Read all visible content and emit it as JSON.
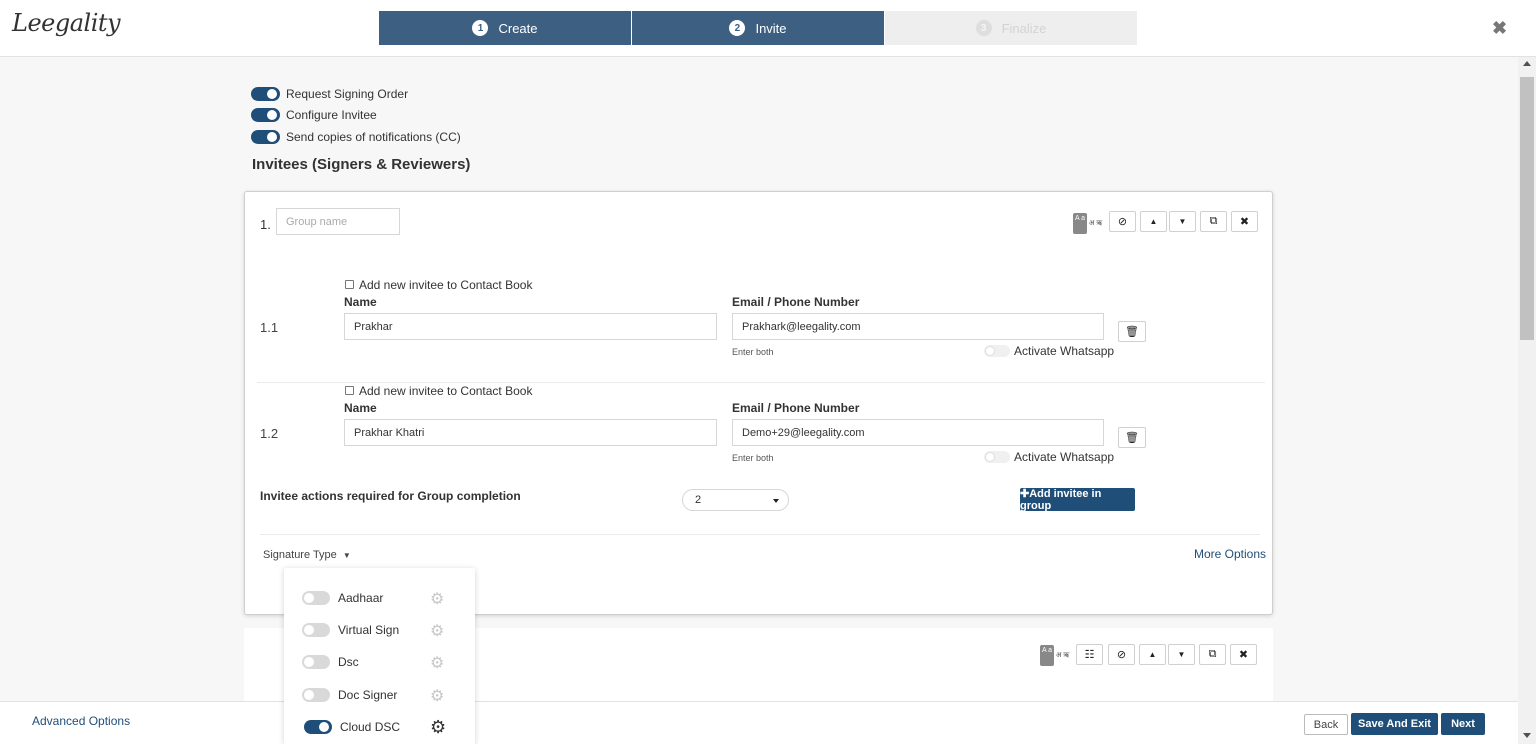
{
  "header": {
    "logo": "Leegality",
    "steps": [
      {
        "num": "1",
        "label": "Create"
      },
      {
        "num": "2",
        "label": "Invite"
      },
      {
        "num": "3",
        "label": "Finalize"
      }
    ],
    "close": "✖"
  },
  "settings": {
    "toggles": [
      {
        "label": "Request Signing Order",
        "on": true
      },
      {
        "label": "Configure Invitee",
        "on": true
      },
      {
        "label": "Send copies of notifications (CC)",
        "on": true
      }
    ]
  },
  "section_title": "Invitees (Signers & Reviewers)",
  "group": {
    "number": "1.",
    "name_placeholder": "Group name",
    "toolbar": {
      "lang_a": "A a",
      "lang_b": "अ ऋ",
      "check": "⊘",
      "up": "▲",
      "down": "▼",
      "copy": "⧉",
      "remove": "✖"
    },
    "invitees": [
      {
        "row": "1.1",
        "contact_book_label": "Add new invitee to Contact Book",
        "name_label": "Name",
        "name_value": "Prakhar",
        "email_label": "Email / Phone Number",
        "email_value": "Prakhark@leegality.com",
        "hint": "Enter both",
        "whatsapp_label": "Activate Whatsapp",
        "delete": "🗑"
      },
      {
        "row": "1.2",
        "contact_book_label": "Add new invitee to Contact Book",
        "name_label": "Name",
        "name_value": "Prakhar Khatri",
        "email_label": "Email / Phone Number",
        "email_value": "Demo+29@leegality.com",
        "hint": "Enter both",
        "whatsapp_label": "Activate Whatsapp",
        "delete": "🗑"
      }
    ],
    "actions_required_label": "Invitee actions required for Group completion",
    "actions_required_value": "2",
    "add_invitee_button": "✚Add invitee in group",
    "signature_type_label": "Signature Type",
    "more_options": "More Options"
  },
  "signature_types": [
    {
      "label": "Aadhaar",
      "on": false
    },
    {
      "label": "Virtual Sign",
      "on": false
    },
    {
      "label": "Dsc",
      "on": false
    },
    {
      "label": "Doc Signer",
      "on": false
    },
    {
      "label": "Cloud DSC",
      "on": true
    }
  ],
  "group2": {
    "toolbar": {
      "lang_a": "A a",
      "lang_b": "अ ऋ",
      "extra": "☷",
      "check": "⊘",
      "up": "▲",
      "down": "▼",
      "copy": "⧉",
      "remove": "✖"
    }
  },
  "footer": {
    "advanced_options": "Advanced Options",
    "back": "Back",
    "save_and_exit": "Save And Exit",
    "next": "Next"
  },
  "colors": {
    "primary": "#1f4e79",
    "step_active": "#3d6082"
  }
}
